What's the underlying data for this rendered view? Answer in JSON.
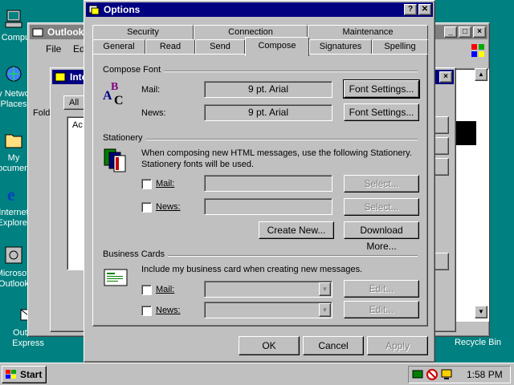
{
  "desktop": {
    "icons": [
      {
        "label": "My Computer"
      },
      {
        "label": "My Network Places"
      },
      {
        "label": "My Documents"
      },
      {
        "label": "Internet Explorer"
      },
      {
        "label": "Microsoft Outlook"
      },
      {
        "label": "Outlook Express"
      },
      {
        "label": "Recycle Bin"
      }
    ]
  },
  "bg_windows": {
    "outlook_title": "Outlook",
    "outlook_menu": [
      "File",
      "Edit"
    ],
    "internet_title": "Interne",
    "folders_label": "Fold",
    "all_tab": "All",
    "acc_label": "Ac"
  },
  "dialog": {
    "title": "Options",
    "tabs_row1": [
      "Security",
      "Connection",
      "Maintenance"
    ],
    "tabs_row2": [
      "General",
      "Read",
      "Send",
      "Compose",
      "Signatures",
      "Spelling"
    ],
    "active_tab": "Compose",
    "compose_font": {
      "group_label": "Compose Font",
      "mail_label": "Mail:",
      "mail_value": "9 pt. Arial",
      "news_label": "News:",
      "news_value": "9 pt. Arial",
      "font_settings_1": "Font Settings...",
      "font_settings_2": "Font Settings..."
    },
    "stationery": {
      "group_label": "Stationery",
      "description": "When composing new HTML messages, use the following Stationery. Stationery fonts will be used.",
      "mail_label": "Mail:",
      "news_label": "News:",
      "select_1": "Select...",
      "select_2": "Select...",
      "create_new": "Create New...",
      "download_more": "Download More..."
    },
    "business_cards": {
      "group_label": "Business Cards",
      "description": "Include my business card when creating new messages.",
      "mail_label": "Mail:",
      "news_label": "News:",
      "edit_1": "Edit...",
      "edit_2": "Edit..."
    },
    "ok": "OK",
    "cancel": "Cancel",
    "apply": "Apply",
    "help_btn": "?",
    "close_btn": "✕"
  },
  "taskbar": {
    "start": "Start",
    "clock": "1:58 PM"
  }
}
